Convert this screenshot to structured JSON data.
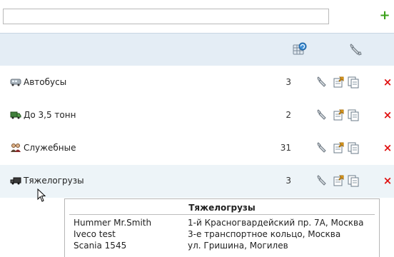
{
  "toolbar": {
    "search_value": "",
    "add_symbol": "+"
  },
  "header": {
    "icons": [
      "database-refresh-icon",
      "wrench-icon"
    ]
  },
  "groups": [
    {
      "label": "Автобусы",
      "count": "3",
      "icon": "bus-icon"
    },
    {
      "label": "До 3,5 тонн",
      "count": "2",
      "icon": "light-truck-icon"
    },
    {
      "label": "Служебные",
      "count": "31",
      "icon": "people-icon"
    },
    {
      "label": "Тяжелогрузы",
      "count": "3",
      "icon": "heavy-truck-icon"
    }
  ],
  "row_actions": {
    "delete_symbol": "×"
  },
  "tooltip": {
    "title": "Тяжелогрузы",
    "rows": [
      {
        "name": "Hummer Mr.Smith",
        "address": "1-й Красногвардейский пр. 7А, Москва"
      },
      {
        "name": "Iveco test",
        "address": "3-е транспортное кольцо, Москва"
      },
      {
        "name": "Scania 1545",
        "address": "ул. Гришина, Могилев"
      }
    ]
  },
  "colors": {
    "header_bg": "#e4edf5",
    "add_green": "#3aa11a",
    "delete_red": "#e01010",
    "hover_row_bg": "#edf4f8"
  }
}
